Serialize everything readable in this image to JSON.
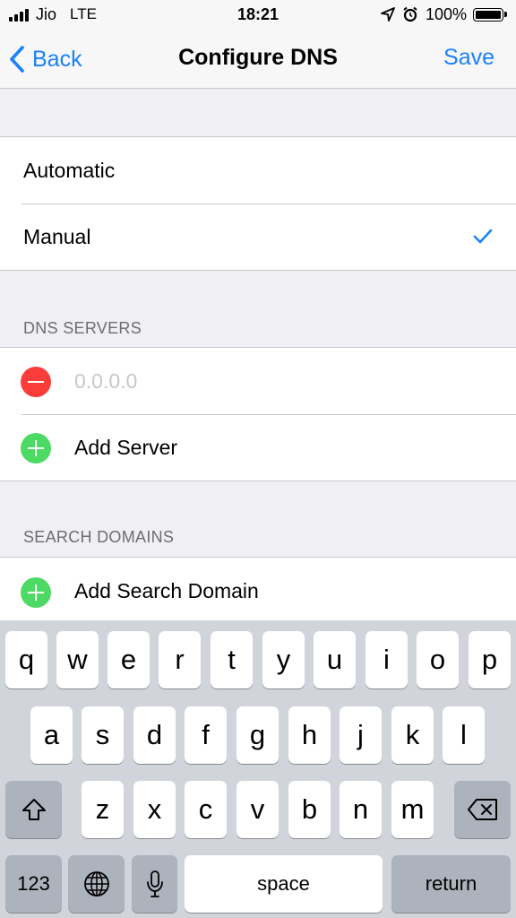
{
  "status_bar": {
    "carrier": "Jio",
    "network": "LTE",
    "time": "18:21",
    "battery": "100%",
    "icons": [
      "signal-icon",
      "location-arrow-icon",
      "alarm-icon",
      "battery-icon"
    ]
  },
  "nav": {
    "back_label": "Back",
    "title": "Configure DNS",
    "save_label": "Save"
  },
  "dns_mode": {
    "options": [
      "Automatic",
      "Manual"
    ],
    "selected": "Manual"
  },
  "dns_servers": {
    "header": "DNS SERVERS",
    "server_placeholder": "0.0.0.0",
    "add_label": "Add Server"
  },
  "search_domains": {
    "header": "SEARCH DOMAINS",
    "add_label": "Add Search Domain"
  },
  "keyboard": {
    "row1": [
      "q",
      "w",
      "e",
      "r",
      "t",
      "y",
      "u",
      "i",
      "o",
      "p"
    ],
    "row2": [
      "a",
      "s",
      "d",
      "f",
      "g",
      "h",
      "j",
      "k",
      "l"
    ],
    "row3": [
      "z",
      "x",
      "c",
      "v",
      "b",
      "n",
      "m"
    ],
    "numbers_label": "123",
    "space_label": "space",
    "return_label": "return"
  },
  "colors": {
    "accent": "#1a82fb",
    "delete": "#fb3d3a",
    "add": "#4cd964"
  }
}
